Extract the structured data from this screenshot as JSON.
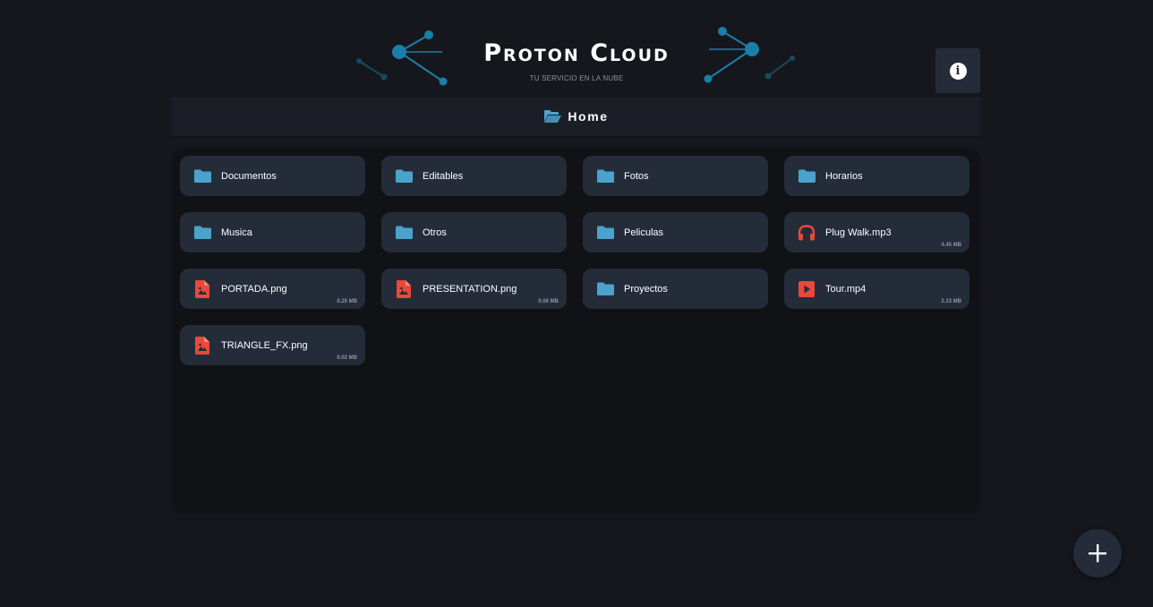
{
  "app": {
    "title": "Proton Cloud",
    "subtitle": "TU SERVICIO EN LA NUBE",
    "info_icon": "info-icon",
    "info_glyph": "i",
    "accent": "#1a7fa8"
  },
  "breadcrumb": {
    "icon": "folder-open-icon",
    "label": "Home"
  },
  "items": [
    {
      "name": "Documentos",
      "type": "folder",
      "size": ""
    },
    {
      "name": "Editables",
      "type": "folder",
      "size": ""
    },
    {
      "name": "Fotos",
      "type": "folder",
      "size": ""
    },
    {
      "name": "Horarios",
      "type": "folder",
      "size": ""
    },
    {
      "name": "Musica",
      "type": "folder",
      "size": ""
    },
    {
      "name": "Otros",
      "type": "folder",
      "size": ""
    },
    {
      "name": "Peliculas",
      "type": "folder",
      "size": ""
    },
    {
      "name": "Plug Walk.mp3",
      "type": "audio",
      "size": "4.45 MB"
    },
    {
      "name": "PORTADA.png",
      "type": "image",
      "size": "0.25 MB"
    },
    {
      "name": "PRESENTATION.png",
      "type": "image",
      "size": "0.06 MB"
    },
    {
      "name": "Proyectos",
      "type": "folder",
      "size": ""
    },
    {
      "name": "Tour.mp4",
      "type": "video",
      "size": "2.13 MB"
    },
    {
      "name": "TRIANGLE_FX.png",
      "type": "image",
      "size": "0.02 MB"
    }
  ],
  "colors": {
    "folder": "#4aa3cc",
    "file": "#e8493b"
  },
  "fab": {
    "icon": "plus-icon"
  }
}
